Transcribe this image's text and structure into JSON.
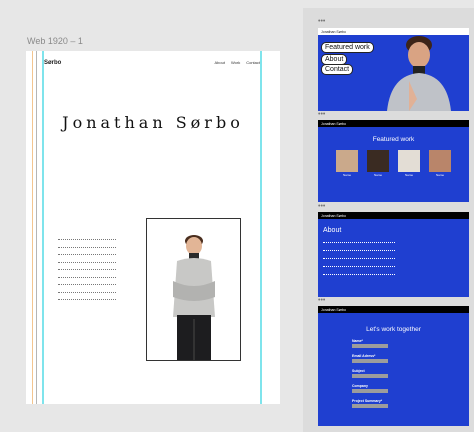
{
  "canvas": {
    "artboard_label": "Web 1920 – 1"
  },
  "artboard": {
    "logo": "Sørbo",
    "nav": [
      "About",
      "Work",
      "Contact"
    ],
    "title": "Jonathan Sørbo"
  },
  "frames": [
    {
      "dots": "•••",
      "bar": "Jonathan Sørbo",
      "buttons": [
        "Featured work",
        "About",
        "Contact"
      ]
    },
    {
      "dots": "•••",
      "bar": "Jonathan Sørbo",
      "heading": "Featured work",
      "thumbs": [
        {
          "caption": "Name",
          "color": "#caa98b"
        },
        {
          "caption": "Name",
          "color": "#3a2b22"
        },
        {
          "caption": "Name",
          "color": "#e3ddd5"
        },
        {
          "caption": "Name",
          "color": "#b9856a"
        }
      ]
    },
    {
      "dots": "•••",
      "bar": "Jonathan Sørbo",
      "heading": "About"
    },
    {
      "dots": "•••",
      "bar": "Jonathan Sørbo",
      "heading": "Let's work together",
      "fields": [
        "Name*",
        "Email Adress*",
        "Subject",
        "Company",
        "Project Summary*"
      ]
    }
  ],
  "colors": {
    "frame_blue": "#1f3fd0",
    "guide_cyan": "#7fe4ec",
    "input_gray": "#9c9c9c"
  }
}
